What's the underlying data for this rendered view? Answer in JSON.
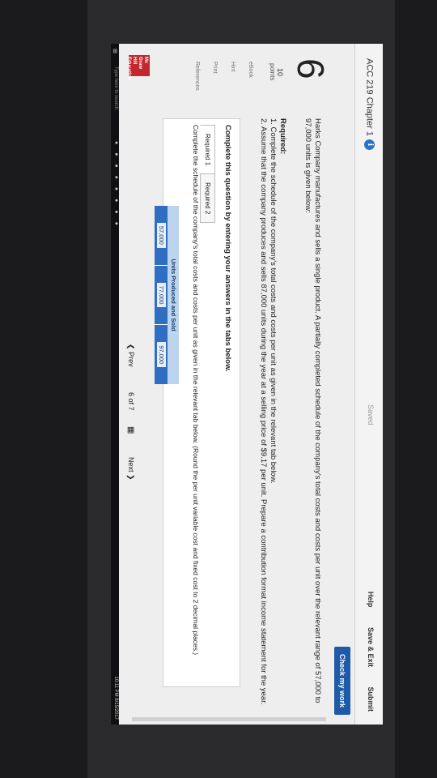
{
  "header": {
    "course_title": "ACC 219 Chapter 1",
    "info_icon": "i",
    "saved": "Saved",
    "help": "Help",
    "save_exit": "Save & Exit",
    "submit": "Submit"
  },
  "check_my_work": "Check my work",
  "question": {
    "number": "6",
    "points_value": "10",
    "points_label": "points",
    "sidebar": [
      "eBook",
      "Hint",
      "Print",
      "References"
    ],
    "text": "Harks Company manufactures and sells a single product. A partially completed schedule of the company's total costs and costs per unit over the relevant range of 57,000 to 97,000 units is given below:",
    "required_heading": "Required:",
    "required_1": "1. Complete the schedule of the company's total costs and costs per unit as given in the relevant tab below.",
    "required_2": "2. Assume that the company produces and sells 87,000 units during the year at a selling price of $9.17 per unit. Prepare a contribution format income statement for the year."
  },
  "instructions": {
    "heading": "Complete this question by entering your answers in the tabs below.",
    "tabs": [
      "Required 1",
      "Required 2"
    ],
    "tab_text": "Complete the schedule of the company's total costs and costs per unit as given in the relevant tab below. (Round the per unit variable cost and fixed cost to 2 decimal places.)",
    "table_header": "Units Produced and Sold",
    "units": [
      "57,000",
      "77,000",
      "97,000"
    ]
  },
  "navigation": {
    "prev": "Prev",
    "page_current": "6",
    "page_of": "of",
    "page_total": "7",
    "next": "Next"
  },
  "logo_text": "Mc Graw Hill Education",
  "taskbar": {
    "search_placeholder": "Type here to search",
    "time": "10:11 PM",
    "date": "8/15/2017"
  }
}
